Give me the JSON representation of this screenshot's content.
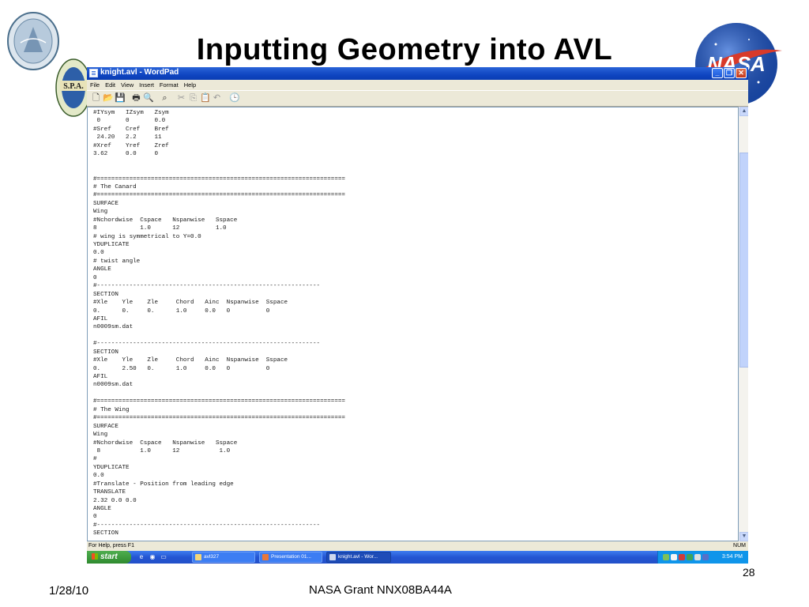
{
  "slide": {
    "title": "Inputting Geometry into AVL",
    "number": "28",
    "date": "1/28/10",
    "footer": "NASA Grant NNX08BA44A"
  },
  "logos": {
    "left_seal": "seal-logo",
    "spa_label": "S.P.A.",
    "nasa_label": "NASA"
  },
  "window": {
    "title": "knight.avl - WordPad",
    "menu": [
      "File",
      "Edit",
      "View",
      "Insert",
      "Format",
      "Help"
    ],
    "toolbar_icons": [
      "new-icon",
      "open-icon",
      "save-icon",
      "print-icon",
      "print-preview-icon",
      "find-icon",
      "cut-icon",
      "copy-icon",
      "paste-icon",
      "undo-icon",
      "date-time-icon"
    ],
    "document_lines": [
      "#IYsym   IZsym   Zsym",
      " 0       0       0.0",
      "#Sref    Cref    Bref",
      " 24.20   2.2     11",
      "#Xref    Yref    Zref",
      "3.62     0.0     0",
      "",
      "",
      "#=====================================================================",
      "# The Canard",
      "#=====================================================================",
      "SURFACE",
      "Wing",
      "#Nchordwise  Cspace   Nspanwise   Sspace",
      "8            1.0      12          1.0",
      "# wing is symmetrical to Y=0.0",
      "YDUPLICATE",
      "0.0",
      "# twist angle",
      "ANGLE",
      "0",
      "#--------------------------------------------------------------",
      "SECTION",
      "#Xle    Yle    Zle     Chord   Ainc  Nspanwise  Sspace",
      "0.      0.     0.      1.0     0.0   0          0",
      "AFIL",
      "n0009sm.dat",
      "",
      "#--------------------------------------------------------------",
      "SECTION",
      "#Xle    Yle    Zle     Chord   Ainc  Nspanwise  Sspace",
      "0.      2.50   0.      1.0     0.0   0          0",
      "AFIL",
      "n0009sm.dat",
      "",
      "#=====================================================================",
      "# The Wing",
      "#=====================================================================",
      "SURFACE",
      "Wing",
      "#Nchordwise  Cspace   Nspanwise   Sspace",
      " 8           1.0      12           1.0",
      "#",
      "YDUPLICATE",
      "0.0",
      "#Translate - Position from leading edge",
      "TRANSLATE",
      "2.32 0.0 0.0",
      "ANGLE",
      "0",
      "#--------------------------------------------------------------",
      "SECTION"
    ],
    "status_left": "For Help, press F1",
    "status_right": "NUM"
  },
  "taskbar": {
    "start_label": "start",
    "items": [
      "avl327",
      "Presentation 01...",
      "knight.avl - Wor..."
    ],
    "clock": "3:54 PM"
  },
  "colors": {
    "titlebar": "#0f45c1",
    "taskbar": "#2455d2",
    "start": "#2f8a2f",
    "tray": "#0f95ea"
  }
}
